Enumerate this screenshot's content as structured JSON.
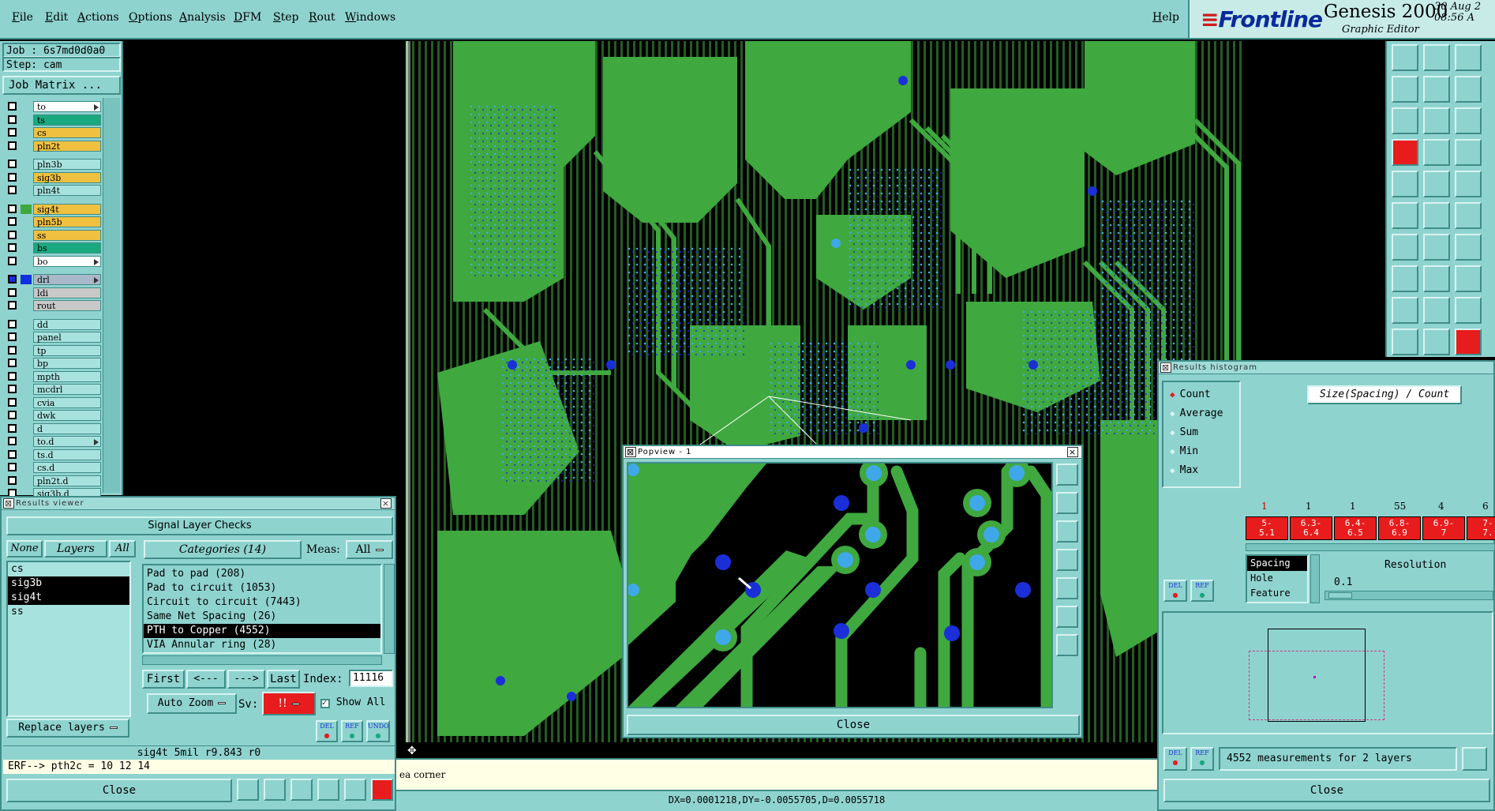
{
  "menubar": {
    "items": [
      "File",
      "Edit",
      "Actions",
      "Options",
      "Analysis",
      "DFM",
      "Step",
      "Rout",
      "Windows"
    ],
    "help": "Help"
  },
  "brand": {
    "logo": "Frontline",
    "app": "Genesis 2000",
    "subtitle": "Graphic Editor",
    "date": "30 Aug 2",
    "time": "08:56 A"
  },
  "left": {
    "job": "Job : 6s7md0d0a0",
    "step": "Step: cam",
    "job_matrix": "Job Matrix ...",
    "layers": [
      {
        "name": "to",
        "color": "#ffffff",
        "arrow": true
      },
      {
        "name": "ts",
        "color": "#19a97e"
      },
      {
        "name": "cs",
        "color": "#f0c040"
      },
      {
        "name": "pln2t",
        "color": "#f0c040"
      },
      {
        "name": "pln3b",
        "color": "#a8e2de"
      },
      {
        "name": "sig3b",
        "color": "#f0c040"
      },
      {
        "name": "pln4t",
        "color": "#a8e2de"
      },
      {
        "name": "sig4t",
        "color": "#f0c040",
        "swatch": "#3fa83f"
      },
      {
        "name": "pln5b",
        "color": "#f0c040"
      },
      {
        "name": "ss",
        "color": "#f0c040"
      },
      {
        "name": "bs",
        "color": "#19a97e"
      },
      {
        "name": "bo",
        "color": "#ffffff",
        "arrow": true
      },
      {
        "name": "drl",
        "color": "#a8b8c8",
        "swatch": "#1030e0",
        "arrow": true
      },
      {
        "name": "ldi",
        "color": "#c8c8c8"
      },
      {
        "name": "rout",
        "color": "#c8c8c8"
      },
      {
        "name": "dd",
        "color": "#a8e2de"
      },
      {
        "name": "panel",
        "color": "#a8e2de"
      },
      {
        "name": "tp",
        "color": "#a8e2de"
      },
      {
        "name": "bp",
        "color": "#a8e2de"
      },
      {
        "name": "mpth",
        "color": "#a8e2de"
      },
      {
        "name": "mcdrl",
        "color": "#a8e2de"
      },
      {
        "name": "cvia",
        "color": "#a8e2de"
      },
      {
        "name": "dwk",
        "color": "#a8e2de"
      },
      {
        "name": "d",
        "color": "#a8e2de"
      },
      {
        "name": "to.d",
        "color": "#a8e2de",
        "arrow": true
      },
      {
        "name": "ts.d",
        "color": "#a8e2de"
      },
      {
        "name": "cs.d",
        "color": "#a8e2de"
      },
      {
        "name": "pln2t.d",
        "color": "#a8e2de"
      },
      {
        "name": "sig3b.d",
        "color": "#a8e2de"
      }
    ]
  },
  "results_viewer": {
    "title": "Results viewer",
    "heading": "Signal Layer Checks",
    "none": "None",
    "layers_label": "Layers",
    "all": "All",
    "categories_label": "Categories (14)",
    "meas_label": "Meas:",
    "meas_value": "All",
    "layer_list": [
      {
        "name": "cs",
        "selected": false
      },
      {
        "name": "sig3b",
        "selected": true
      },
      {
        "name": "sig4t",
        "selected": true
      },
      {
        "name": "ss",
        "selected": false
      }
    ],
    "categories": [
      {
        "name": "Pad to pad (208)",
        "selected": false
      },
      {
        "name": "Pad to circuit (1053)",
        "selected": false
      },
      {
        "name": "Circuit to circuit (7443)",
        "selected": false
      },
      {
        "name": "Same Net Spacing (26)",
        "selected": false
      },
      {
        "name": "PTH to Copper (4552)",
        "selected": true
      },
      {
        "name": "VIA Annular ring (28)",
        "selected": false
      }
    ],
    "first": "First",
    "prev": "<---",
    "next": "--->",
    "last": "Last",
    "index_label": "Index:",
    "index_value": "11116",
    "auto_zoom": "Auto Zoom",
    "sv_label": "Sv:",
    "sv_value": "!!",
    "show_all": "Show All",
    "replace_layers": "Replace layers",
    "del": "DEL",
    "ref": "REF",
    "undo": "UNDO",
    "info_line": "sig4t 5mil  r9.843  r0",
    "erf_line": "ERF--> pth2c = 10 12 14",
    "close": "Close"
  },
  "status": {
    "message": "ea corner",
    "coords": "DX=0.0001218,DY=-0.0055705,D=0.0055718"
  },
  "popview": {
    "title": "Popview - 1",
    "close": "Close"
  },
  "histogram": {
    "title": "Results histogram",
    "modes": [
      {
        "name": "Count",
        "selected": true
      },
      {
        "name": "Average",
        "selected": false
      },
      {
        "name": "Sum",
        "selected": false
      },
      {
        "name": "Min",
        "selected": false
      },
      {
        "name": "Max",
        "selected": false
      }
    ],
    "axis_title": "Size(Spacing) / Count",
    "bins": [
      {
        "count": "1",
        "range": "5-\n5.1"
      },
      {
        "count": "1",
        "range": "6.3-\n6.4"
      },
      {
        "count": "1",
        "range": "6.4-\n6.5"
      },
      {
        "count": "55",
        "range": "6.8-\n6.9"
      },
      {
        "count": "4",
        "range": "6.9-\n7"
      },
      {
        "count": "6",
        "range": "7-\n7."
      }
    ],
    "measure_types": [
      {
        "name": "Spacing",
        "selected": true
      },
      {
        "name": "Hole",
        "selected": false
      },
      {
        "name": "Feature",
        "selected": false
      }
    ],
    "resolution_label": "Resolution",
    "resolution_value": "0.1",
    "del": "DEL",
    "ref": "REF",
    "summary": "4552 measurements for 2 layers",
    "close": "Close"
  }
}
